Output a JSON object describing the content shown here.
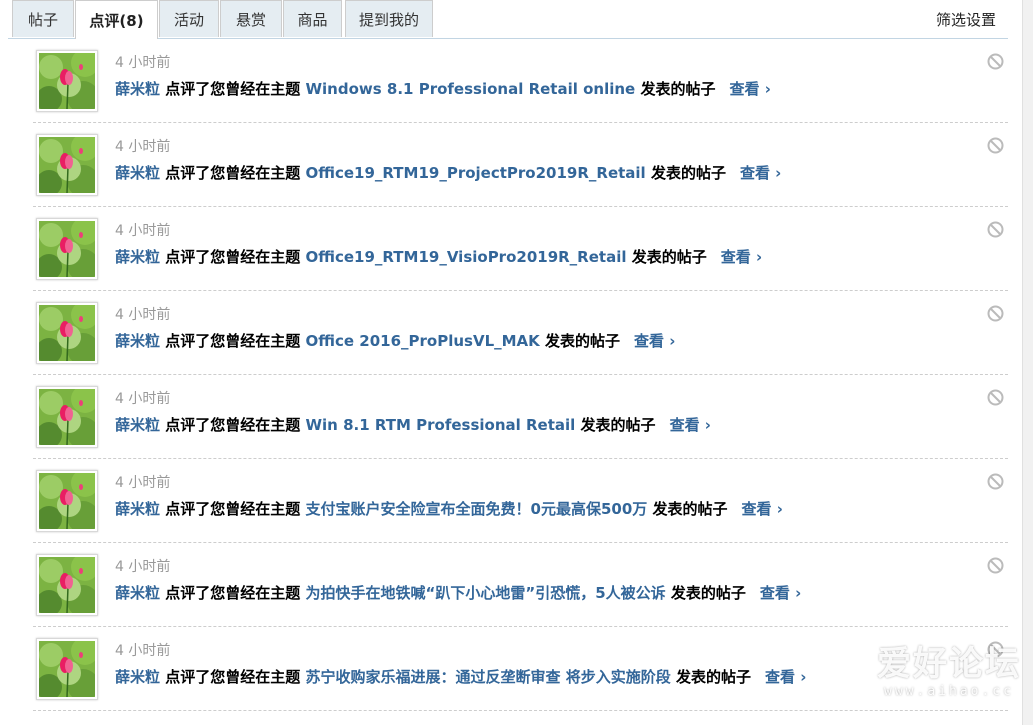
{
  "tabs": [
    {
      "label": "帖子"
    },
    {
      "label": "点评(8)"
    },
    {
      "label": "活动"
    },
    {
      "label": "悬赏"
    },
    {
      "label": "商品"
    },
    {
      "label": "提到我的"
    }
  ],
  "filter_label": "筛选设置",
  "items": [
    {
      "time": "4 小时前",
      "user": "薛米粒",
      "action": "点评了您曾经在主题",
      "thread": "Windows 8.1 Professional Retail online",
      "suffix": "发表的帖子",
      "view": "查看 ›"
    },
    {
      "time": "4 小时前",
      "user": "薛米粒",
      "action": "点评了您曾经在主题",
      "thread": "Office19_RTM19_ProjectPro2019R_Retail",
      "suffix": "发表的帖子",
      "view": "查看 ›"
    },
    {
      "time": "4 小时前",
      "user": "薛米粒",
      "action": "点评了您曾经在主题",
      "thread": "Office19_RTM19_VisioPro2019R_Retail",
      "suffix": "发表的帖子",
      "view": "查看 ›"
    },
    {
      "time": "4 小时前",
      "user": "薛米粒",
      "action": "点评了您曾经在主题",
      "thread": "Office 2016_ProPlusVL_MAK",
      "suffix": "发表的帖子",
      "view": "查看 ›"
    },
    {
      "time": "4 小时前",
      "user": "薛米粒",
      "action": "点评了您曾经在主题",
      "thread": "Win 8.1 RTM Professional Retail",
      "suffix": "发表的帖子",
      "view": "查看 ›"
    },
    {
      "time": "4 小时前",
      "user": "薛米粒",
      "action": "点评了您曾经在主题",
      "thread": "支付宝账户安全险宣布全面免费！0元最高保500万",
      "suffix": "发表的帖子",
      "view": "查看 ›"
    },
    {
      "time": "4 小时前",
      "user": "薛米粒",
      "action": "点评了您曾经在主题",
      "thread": "为拍快手在地铁喊“趴下小心地雷”引恐慌，5人被公诉",
      "suffix": "发表的帖子",
      "view": "查看 ›"
    },
    {
      "time": "4 小时前",
      "user": "薛米粒",
      "action": "点评了您曾经在主题",
      "thread": "苏宁收购家乐福进展：通过反垄断审查 将步入实施阶段",
      "suffix": "发表的帖子",
      "view": "查看 ›"
    }
  ],
  "watermark": {
    "title": "爱好论坛",
    "url": "www.aihao.cc"
  },
  "colors": {
    "link": "#336699",
    "tab_bg": "#e5edf2",
    "border": "#c2d5e3"
  }
}
